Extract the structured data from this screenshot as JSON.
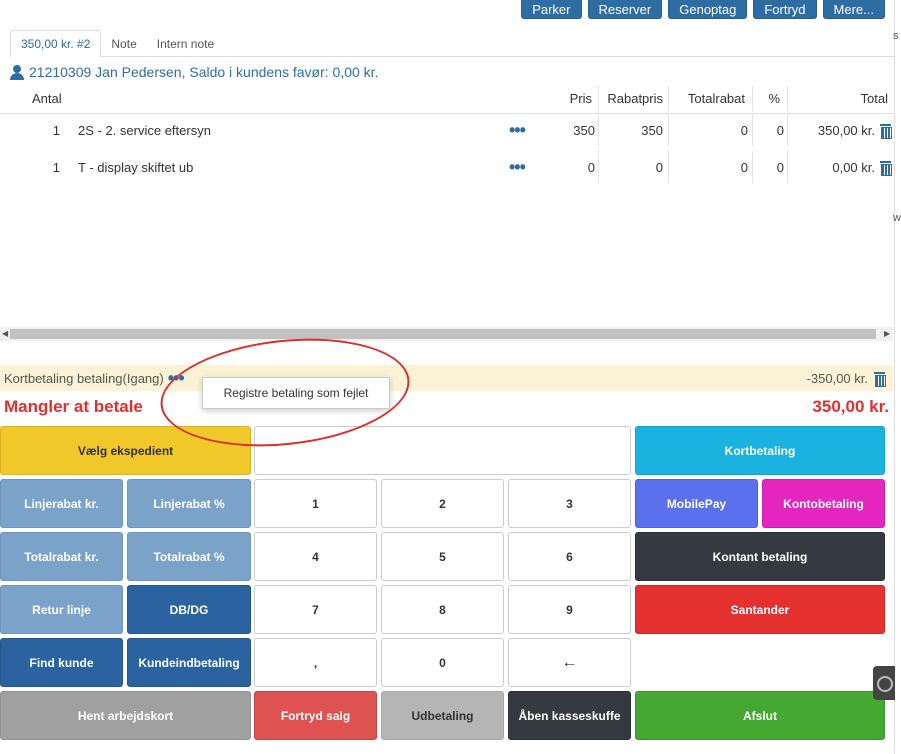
{
  "toolbar": {
    "parker": "Parker",
    "reserver": "Reserver",
    "genoptag": "Genoptag",
    "fortryd": "Fortryd",
    "mere": "Mere..."
  },
  "tabs": [
    "350,00 kr. #2",
    "Note",
    "Intern note"
  ],
  "customer": "21210309 Jan Pedersen, Saldo i kundens favør: 0,00 kr.",
  "table": {
    "headers": {
      "antal": "Antal",
      "pris": "Pris",
      "rabatpris": "Rabatpris",
      "totalrabat": "Totalrabat",
      "pct": "%",
      "total": "Total"
    },
    "rows": [
      {
        "antal": "1",
        "name": "2S - 2. service eftersyn",
        "dots": "•••",
        "pris": "350",
        "rabatpris": "350",
        "totalrabat": "0",
        "pct": "0",
        "total": "350,00 kr."
      },
      {
        "antal": "1",
        "name": "T - display skiftet ub",
        "dots": "•••",
        "pris": "0",
        "rabatpris": "0",
        "totalrabat": "0",
        "pct": "0",
        "total": "0,00 kr."
      }
    ]
  },
  "payment": {
    "label": "Kortbetaling betaling(Igang)",
    "dots": "•••",
    "amount": "-350,00 kr.",
    "popup": "Registre betaling som fejlet"
  },
  "due": {
    "label": "Mangler at betale",
    "amount": "350,00 kr."
  },
  "keypad": {
    "vaelg": "Vælg ekspedient",
    "input_value": "",
    "kortbetaling": "Kortbetaling",
    "linjerabat_kr": "Linjerabat kr.",
    "linjerabat_pct": "Linjerabat %",
    "k1": "1",
    "k2": "2",
    "k3": "3",
    "mobilepay": "MobilePay",
    "kontobetaling": "Kontobetaling",
    "totalrabat_kr": "Totalrabat kr.",
    "totalrabat_pct": "Totalrabat %",
    "k4": "4",
    "k5": "5",
    "k6": "6",
    "kontant": "Kontant betaling",
    "retur": "Retur linje",
    "dbdg": "DB/DG",
    "k7": "7",
    "k8": "8",
    "k9": "9",
    "santander": "Santander",
    "find_kunde": "Find kunde",
    "kundeindbetaling": "Kundeindbetaling",
    "comma": ",",
    "k0": "0",
    "backspace": "←",
    "hent": "Hent arbejdskort",
    "fortryd_salg": "Fortryd salg",
    "udbetaling": "Udbetaling",
    "aaben": "Åben kasseskuffe",
    "afslut": "Afslut"
  },
  "edge_chars": [
    "s",
    "w"
  ]
}
